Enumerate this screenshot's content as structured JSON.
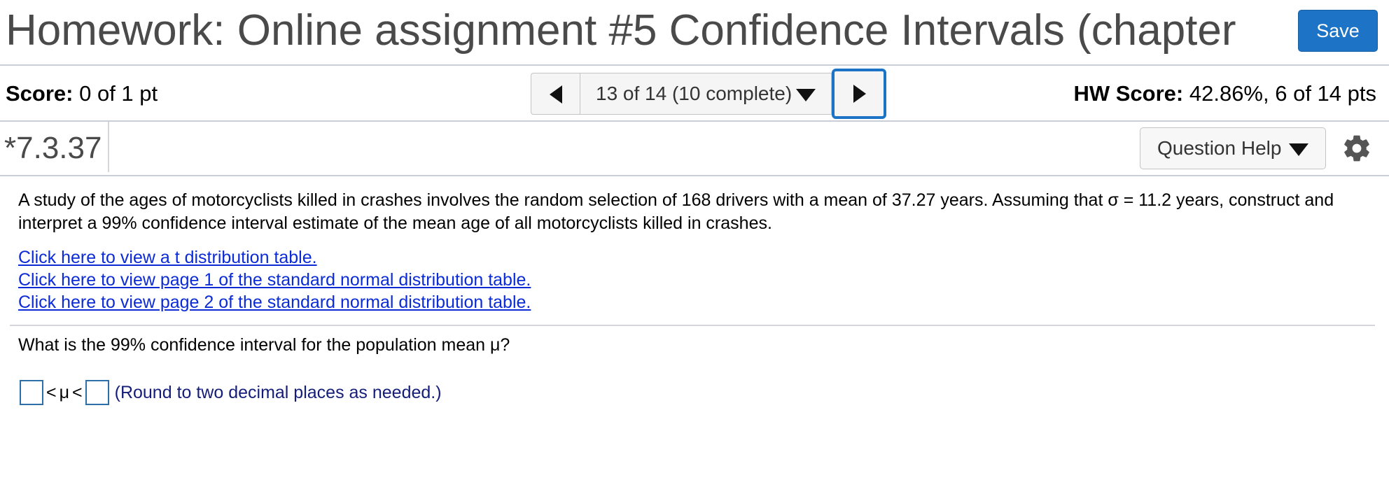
{
  "header": {
    "title": "Homework: Online assignment #5 Confidence Intervals (chapter",
    "save_label": "Save"
  },
  "score": {
    "label": "Score:",
    "value": "0 of 1 pt"
  },
  "hw_score": {
    "label": "HW Score:",
    "value": "42.86%, 6 of 14 pts"
  },
  "navigation": {
    "position_text": "13 of 14 (10 complete)"
  },
  "question": {
    "id": "*7.3.37",
    "help_label": "Question Help",
    "problem_text": "A study of the ages of motorcyclists killed in crashes involves the random selection of 168 drivers with a mean of 37.27 years. Assuming that σ = 11.2 years, construct and interpret a 99% confidence interval estimate of the mean age of all motorcyclists killed in crashes.",
    "links": [
      "Click here to view a t distribution table.",
      "Click here to view page 1 of the standard normal distribution table.",
      "Click here to view page 2 of the standard normal distribution table."
    ],
    "prompt": "What is the 99% confidence interval for the population mean μ?",
    "answer": {
      "symbol_left": "<",
      "symbol_mid": "μ",
      "symbol_right": "<",
      "hint": "(Round to two decimal places as needed.)",
      "lower_value": "",
      "upper_value": ""
    }
  },
  "colors": {
    "accent": "#1d74c7",
    "link": "#0b2bd6",
    "hint": "#151d7a"
  }
}
